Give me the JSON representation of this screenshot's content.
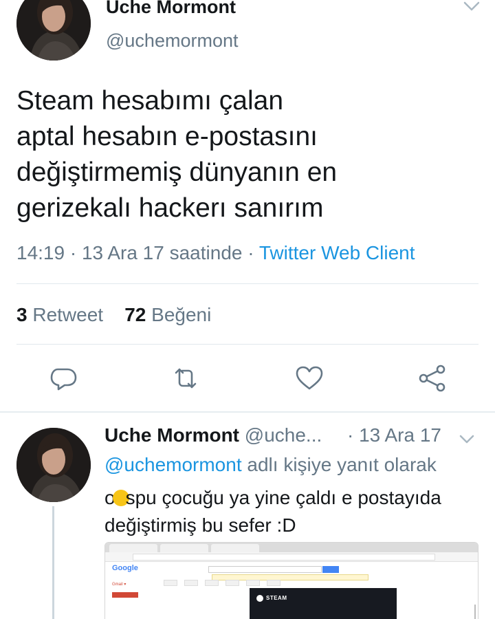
{
  "main_tweet": {
    "display_name": "Uche Mormont",
    "handle": "@uchemormont",
    "text_lines": [
      "Steam hesabımı çalan",
      "aptal hesabın e-postasını",
      "değiştirmemiş dünyanın en",
      "gerizekalı hackerı sanırım"
    ],
    "timestamp": "14:19 · 13 Ara 17 saatinde · ",
    "client": "Twitter Web Client",
    "retweet_count": "3",
    "retweet_label": "Retweet",
    "like_count": "72",
    "like_label": "Beğeni"
  },
  "reply_tweet": {
    "display_name": "Uche Mormont",
    "handle": "@uche...",
    "date": "· 13 Ara 17",
    "reply_to_mention": "@uchemormont",
    "reply_to_suffix": " adlı kişiye yanıt olarak",
    "text_line1_start": "o",
    "text_line1_end": "spu çocuğu ya yine çaldı e postayıda",
    "text_line2": "değiştirmiş bu sefer :D"
  },
  "embedded_screenshot": {
    "brand": "Google",
    "gmail_label": "Gmail ▾",
    "steam_label": "STEAM"
  },
  "icons": {
    "reply": "reply-icon",
    "retweet": "retweet-icon",
    "like": "heart-icon",
    "share": "share-icon",
    "menu": "chevron-down-icon"
  },
  "colors": {
    "link": "#1b95e0",
    "secondary_text": "#657786",
    "primary_text": "#14171a",
    "divider": "#e1e8ed"
  }
}
